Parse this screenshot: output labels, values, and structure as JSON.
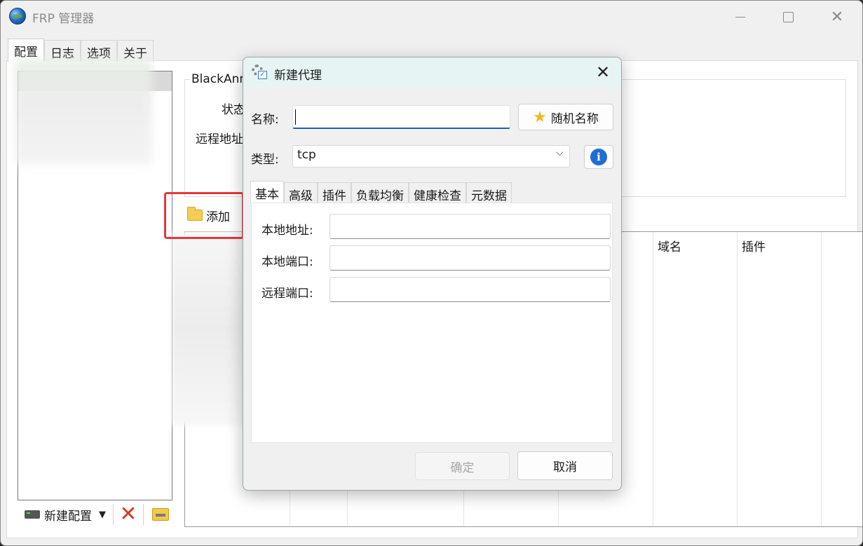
{
  "app": {
    "title": "FRP 管理器"
  },
  "main_tabs": [
    {
      "label": "配置",
      "active": true
    },
    {
      "label": "日志"
    },
    {
      "label": "选项"
    },
    {
      "label": "关于"
    }
  ],
  "config_panel": {
    "group_title": "BlackAnn",
    "status_label": "状态",
    "remote_label": "远程地址",
    "add_label": "添加",
    "table_columns": [
      "域名",
      "插件"
    ]
  },
  "sidebar_toolbar": {
    "new_config_label": "新建配置"
  },
  "dialog": {
    "title": "新建代理",
    "name_label": "名称:",
    "name_value": "",
    "random_name_label": "随机名称",
    "type_label": "类型:",
    "type_value": "tcp",
    "tabs": [
      {
        "label": "基本",
        "active": true
      },
      {
        "label": "高级"
      },
      {
        "label": "插件"
      },
      {
        "label": "负载均衡"
      },
      {
        "label": "健康检查"
      },
      {
        "label": "元数据"
      }
    ],
    "fields": {
      "local_address_label": "本地地址:",
      "local_port_label": "本地端口:",
      "remote_port_label": "远程端口:"
    },
    "ok_label": "确定",
    "ok_enabled": false,
    "cancel_label": "取消"
  },
  "colors": {
    "highlight": "#e8373a",
    "accent": "#1d5fb0",
    "dialog_title_bg": "#e6f5f3"
  },
  "icons": {
    "app": "globe-icon",
    "random_name": "star-icon",
    "info": "info-icon",
    "add": "folder-icon",
    "delete": "delete-icon",
    "new_config": "drive-icon",
    "import": "folder-zip-icon"
  }
}
